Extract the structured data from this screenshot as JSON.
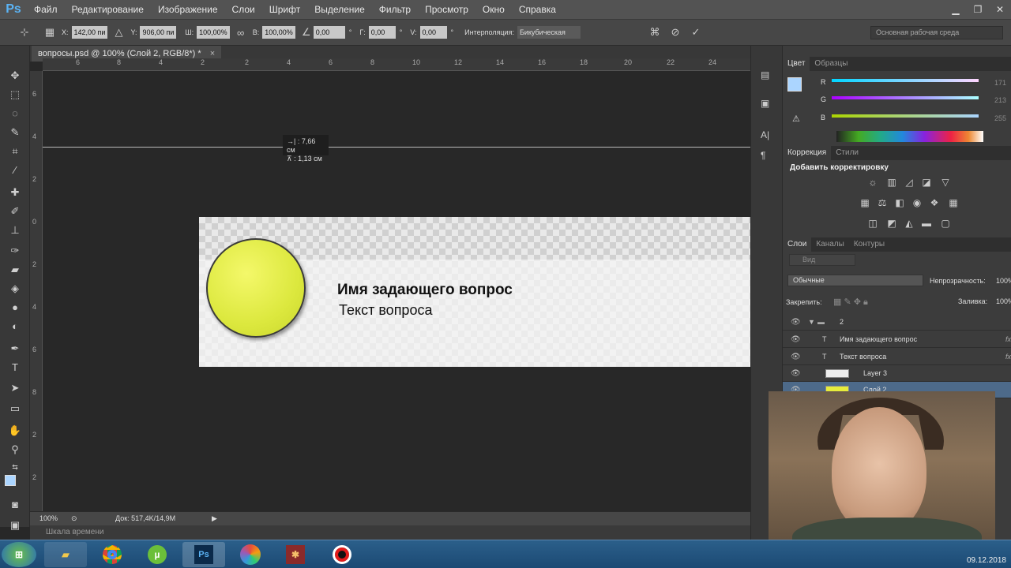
{
  "app": {
    "name": "Ps"
  },
  "menu": [
    "Файл",
    "Редактирование",
    "Изображение",
    "Слои",
    "Шрифт",
    "Выделение",
    "Фильтр",
    "Просмотр",
    "Окно",
    "Справка"
  ],
  "options": {
    "x_label": "X:",
    "x_value": "142,00 пи",
    "y_label": "Y:",
    "y_value": "906,00 пи",
    "w_label": "Ш:",
    "w_value": "100,00%",
    "h_label": "В:",
    "h_value": "100,00%",
    "angle_value": "0,00",
    "hskew_label": "Г:",
    "hskew_value": "0,00",
    "vskew_label": "V:",
    "vskew_value": "0,00",
    "interp_label": "Интерполяция:",
    "interp_value": "Бикубическая",
    "workspace": "Основная рабочая среда"
  },
  "document": {
    "tab_title": "вопросы.psd @ 100% (Слой 2, RGB/8*) *",
    "measure_x": "7,66 см",
    "measure_y": "1,13 см",
    "asker_name": "Имя задающего вопрос",
    "question_text": "Текст вопроса"
  },
  "ruler": {
    "h": [
      "6",
      "8",
      "4",
      "2",
      "0",
      "2",
      "4",
      "6",
      "8",
      "10",
      "12",
      "14",
      "16",
      "18",
      "20",
      "22",
      "24"
    ],
    "v": [
      "6",
      "4",
      "2",
      "0",
      "2",
      "4",
      "6",
      "8",
      "2",
      "2"
    ]
  },
  "status": {
    "zoom": "100%",
    "doc_info": "Док: 517,4K/14,9M",
    "timeline": "Шкала времени"
  },
  "color_panel": {
    "tabs": [
      "Цвет",
      "Образцы"
    ],
    "r_label": "R",
    "g_label": "G",
    "b_label": "B",
    "r_value": "171",
    "g_value": "213",
    "b_value": "255",
    "fg": "#abd5ff"
  },
  "adjust_panel": {
    "tabs": [
      "Коррекция",
      "Стили"
    ],
    "title": "Добавить корректировку"
  },
  "layers_panel": {
    "tabs": [
      "Слои",
      "Каналы",
      "Контуры"
    ],
    "filter": "Вид",
    "blend": "Обычные",
    "opacity_label": "Непрозрачность:",
    "opacity_value": "100%",
    "lock_label": "Закрепить:",
    "fill_label": "Заливка:",
    "fill_value": "100%",
    "layers": [
      {
        "name": "2",
        "type": "group"
      },
      {
        "name": "Имя задающего вопрос",
        "type": "text"
      },
      {
        "name": "Текст вопроса",
        "type": "text"
      },
      {
        "name": "Layer 3",
        "type": "image"
      },
      {
        "name": "Слой 2",
        "type": "image"
      }
    ]
  },
  "taskbar": {
    "clock": "09.12.2018"
  }
}
